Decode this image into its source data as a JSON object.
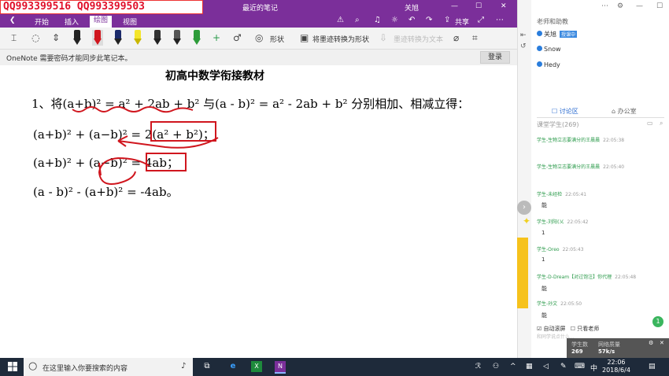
{
  "watermark": "QQ993399516  QQ993399503",
  "titlebar": {
    "title": "最近的笔记",
    "user": "关旭"
  },
  "tabs": {
    "start": "开始",
    "insert": "插入",
    "draw": "绘图",
    "view": "视图",
    "share": "共享"
  },
  "ribbon": {
    "shapes": "形状",
    "ink_to_shape": "将墨迹转换为形状",
    "ink_to_text": "墨迹转换为文本"
  },
  "infobar": {
    "message": "OneNote 需要密码才能同步此笔记本。",
    "login": "登录"
  },
  "page": {
    "heading": "初高中数学衔接教材",
    "line1": "1、将(a+b)² = a² + 2ab + b² 与(a - b)² = a² - 2ab + b² 分别相加、相减立得：",
    "line2": "(a+b)² + (a−b)² = 2(a² + b²)；",
    "line3": "(a+b)² + (a−b)² = 4ab；",
    "line4": "(a - b)² - (a+b)² = -4ab。"
  },
  "panel": {
    "teacher": "老师和助教",
    "users": [
      {
        "name": "关旭",
        "badge": "授课中"
      },
      {
        "name": "Snow"
      },
      {
        "name": "Hedy"
      }
    ],
    "tab_discussion": "讨论区",
    "tab_office": "办公室",
    "selector": "课堂学生(269)",
    "messages": [
      {
        "user": "学生-生物立志要满分的王晨晨",
        "time": "22:05:38",
        "text": ""
      },
      {
        "user": "学生-生物立志要满分的王晨晨",
        "time": "22:05:40",
        "text": ""
      },
      {
        "user": "学生-未经检",
        "time": "22:05:41",
        "text": "能"
      },
      {
        "user": "学生-刘阳(乂",
        "time": "22:05:42",
        "text": "1"
      },
      {
        "user": "学生-Oreo",
        "time": "22:05:43",
        "text": "1"
      },
      {
        "user": "学生-D-Dream【对过饱注】你代理",
        "time": "22:05:48",
        "text": "能"
      },
      {
        "user": "学生-孙文",
        "time": "22:05:50",
        "text": "能"
      }
    ],
    "auto_scroll": "自动滚屏",
    "only_teacher": "只看老师",
    "input_placeholder": "和同学说点什么..."
  },
  "stats": {
    "students_label": "学生数",
    "students": "269",
    "net_label": "网络质量",
    "net": "57k/s"
  },
  "taskbar": {
    "search_placeholder": "在这里输入你要搜索的内容",
    "time": "22:06",
    "date": "2018/6/4",
    "ime": "中"
  },
  "notif_count": "1"
}
